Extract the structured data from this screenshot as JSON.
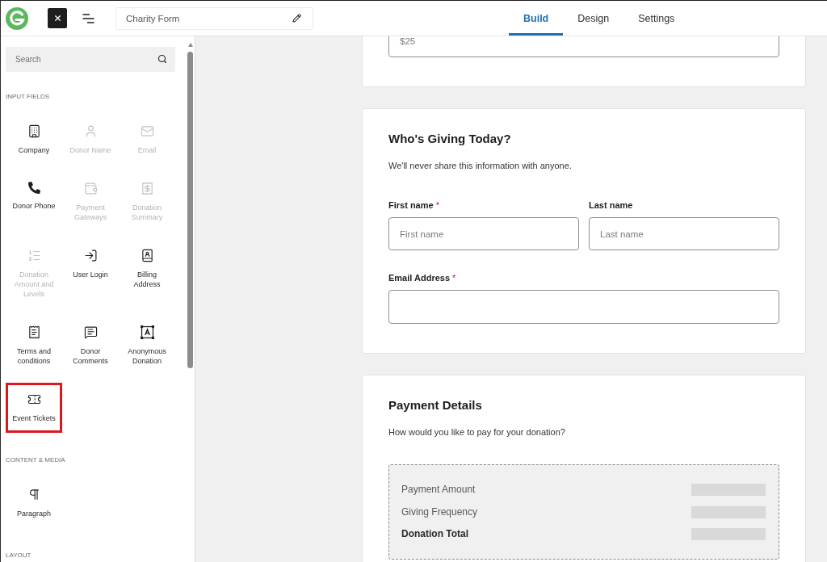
{
  "header": {
    "form_title": "Charity Form",
    "tabs": [
      {
        "label": "Build",
        "selected": true
      },
      {
        "label": "Design",
        "selected": false
      },
      {
        "label": "Settings",
        "selected": false
      }
    ]
  },
  "sidebar": {
    "search": {
      "placeholder": "Search"
    },
    "sections": [
      {
        "title": "INPUT FIELDS",
        "items": [
          {
            "label": "Company",
            "disabled": false,
            "highlighted": false
          },
          {
            "label": "Donor Name",
            "disabled": true,
            "highlighted": false
          },
          {
            "label": "Email",
            "disabled": true,
            "highlighted": false
          },
          {
            "label": "Donor Phone",
            "disabled": false,
            "highlighted": false
          },
          {
            "label": "Payment Gateways",
            "disabled": true,
            "highlighted": false
          },
          {
            "label": "Donation Summary",
            "disabled": true,
            "highlighted": false
          },
          {
            "label": "Donation Amount and Levels",
            "disabled": true,
            "highlighted": false
          },
          {
            "label": "User Login",
            "disabled": false,
            "highlighted": false
          },
          {
            "label": "Billing Address",
            "disabled": false,
            "highlighted": false
          },
          {
            "label": "Terms and conditions",
            "disabled": false,
            "highlighted": false
          },
          {
            "label": "Donor Comments",
            "disabled": false,
            "highlighted": false
          },
          {
            "label": "Anonymous Donation",
            "disabled": false,
            "highlighted": false
          },
          {
            "label": "Event Tickets",
            "disabled": false,
            "highlighted": true
          }
        ]
      },
      {
        "title": "CONTENT & MEDIA",
        "items": [
          {
            "label": "Paragraph",
            "disabled": false,
            "highlighted": false
          }
        ]
      },
      {
        "title": "LAYOUT"
      }
    ]
  },
  "form": {
    "amount_field": {
      "placeholder": "$25"
    },
    "donor_section": {
      "title": "Who's Giving Today?",
      "description": "We'll never share this information with anyone.",
      "rows": [
        [
          {
            "label": "First name",
            "required_mark": "*",
            "placeholder": "First name"
          },
          {
            "label": "Last name",
            "placeholder": "Last name"
          }
        ],
        [
          {
            "label": "Email Address",
            "required_mark": "*"
          }
        ]
      ]
    },
    "payment_section": {
      "title": "Payment Details",
      "description": "How would you like to pay for your donation?",
      "summary": [
        {
          "label": "Payment Amount",
          "kind": "line"
        },
        {
          "label": "Giving Frequency",
          "kind": "line"
        },
        {
          "label": "Donation Total",
          "kind": "total"
        }
      ]
    }
  }
}
